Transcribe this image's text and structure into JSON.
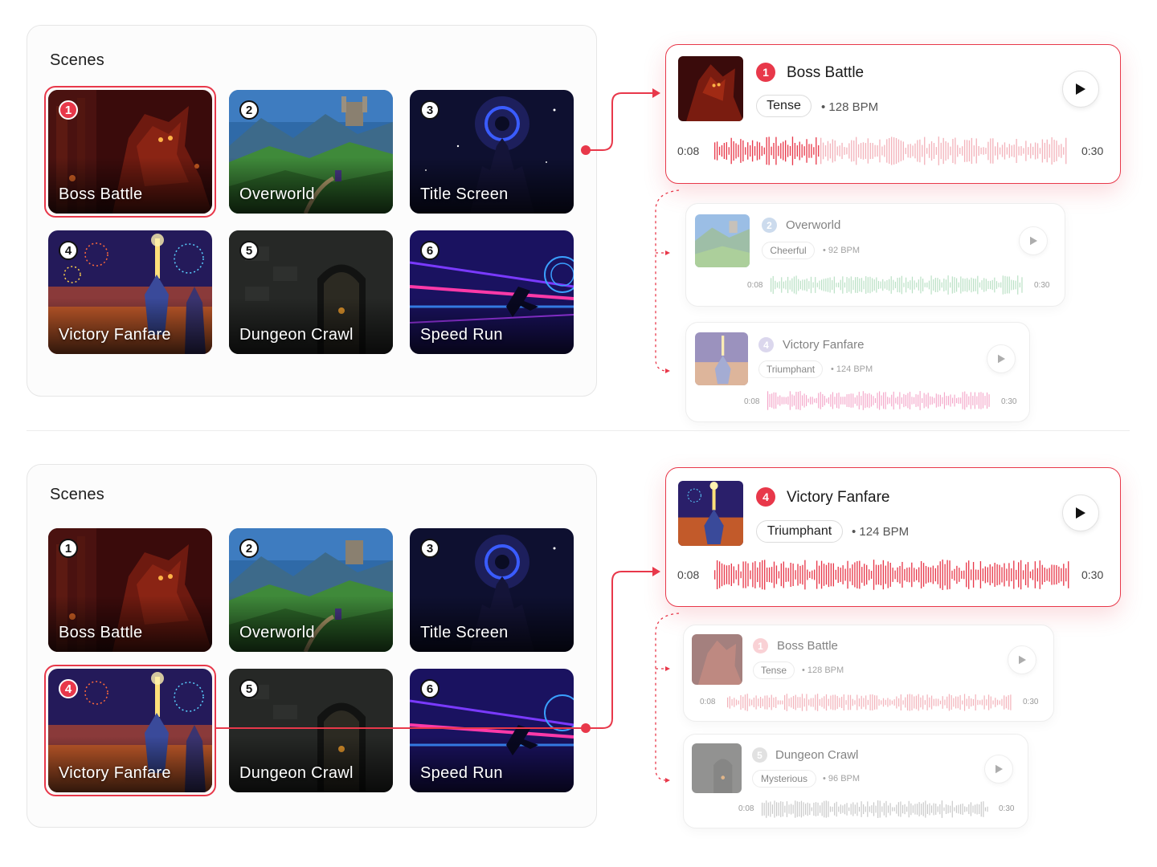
{
  "colors": {
    "accent": "#e8384a",
    "waveMuted": "#f3b3bb",
    "waveGreen": "#b9e0c4",
    "wavePink": "#f4a6c9"
  },
  "top": {
    "panel": {
      "title": "Scenes",
      "tiles": [
        {
          "n": "1",
          "label": "Boss Battle",
          "art": "boss-battle-art",
          "selected": true
        },
        {
          "n": "2",
          "label": "Overworld",
          "art": "overworld-art",
          "selected": false
        },
        {
          "n": "3",
          "label": "Title Screen",
          "art": "title-screen-art",
          "selected": false
        },
        {
          "n": "4",
          "label": "Victory Fanfare",
          "art": "victory-fanfare-art",
          "selected": false
        },
        {
          "n": "5",
          "label": "Dungeon Crawl",
          "art": "dungeon-crawl-art",
          "selected": false
        },
        {
          "n": "6",
          "label": "Speed Run",
          "art": "speed-run-art",
          "selected": false
        }
      ]
    },
    "active": {
      "n": "1",
      "title": "Boss Battle",
      "mood": "Tense",
      "bpm": "128 BPM",
      "time_current": "0:08",
      "time_total": "0:30",
      "progress": 0.3
    },
    "queue": [
      {
        "n": "2",
        "title": "Overworld",
        "mood": "Cheerful",
        "bpm": "92 BPM",
        "time_current": "0:08",
        "time_total": "0:30"
      },
      {
        "n": "4",
        "title": "Victory Fanfare",
        "mood": "Triumphant",
        "bpm": "124 BPM",
        "time_current": "0:08",
        "time_total": "0:30"
      }
    ]
  },
  "bottom": {
    "panel": {
      "title": "Scenes",
      "tiles": [
        {
          "n": "1",
          "label": "Boss Battle",
          "art": "boss-battle-art",
          "selected": false
        },
        {
          "n": "2",
          "label": "Overworld",
          "art": "overworld-art",
          "selected": false
        },
        {
          "n": "3",
          "label": "Title Screen",
          "art": "title-screen-art",
          "selected": false
        },
        {
          "n": "4",
          "label": "Victory Fanfare",
          "art": "victory-fanfare-art",
          "selected": true
        },
        {
          "n": "5",
          "label": "Dungeon Crawl",
          "art": "dungeon-crawl-art",
          "selected": false
        },
        {
          "n": "6",
          "label": "Speed Run",
          "art": "speed-run-art",
          "selected": false
        }
      ]
    },
    "active": {
      "n": "4",
      "title": "Victory Fanfare",
      "mood": "Triumphant",
      "bpm": "124 BPM",
      "time_current": "0:08",
      "time_total": "0:30",
      "progress": 1.0
    },
    "queue": [
      {
        "n": "1",
        "title": "Boss Battle",
        "mood": "Tense",
        "bpm": "128 BPM",
        "time_current": "0:08",
        "time_total": "0:30"
      },
      {
        "n": "5",
        "title": "Dungeon Crawl",
        "mood": "Mysterious",
        "bpm": "96 BPM",
        "time_current": "0:08",
        "time_total": "0:30"
      }
    ]
  }
}
